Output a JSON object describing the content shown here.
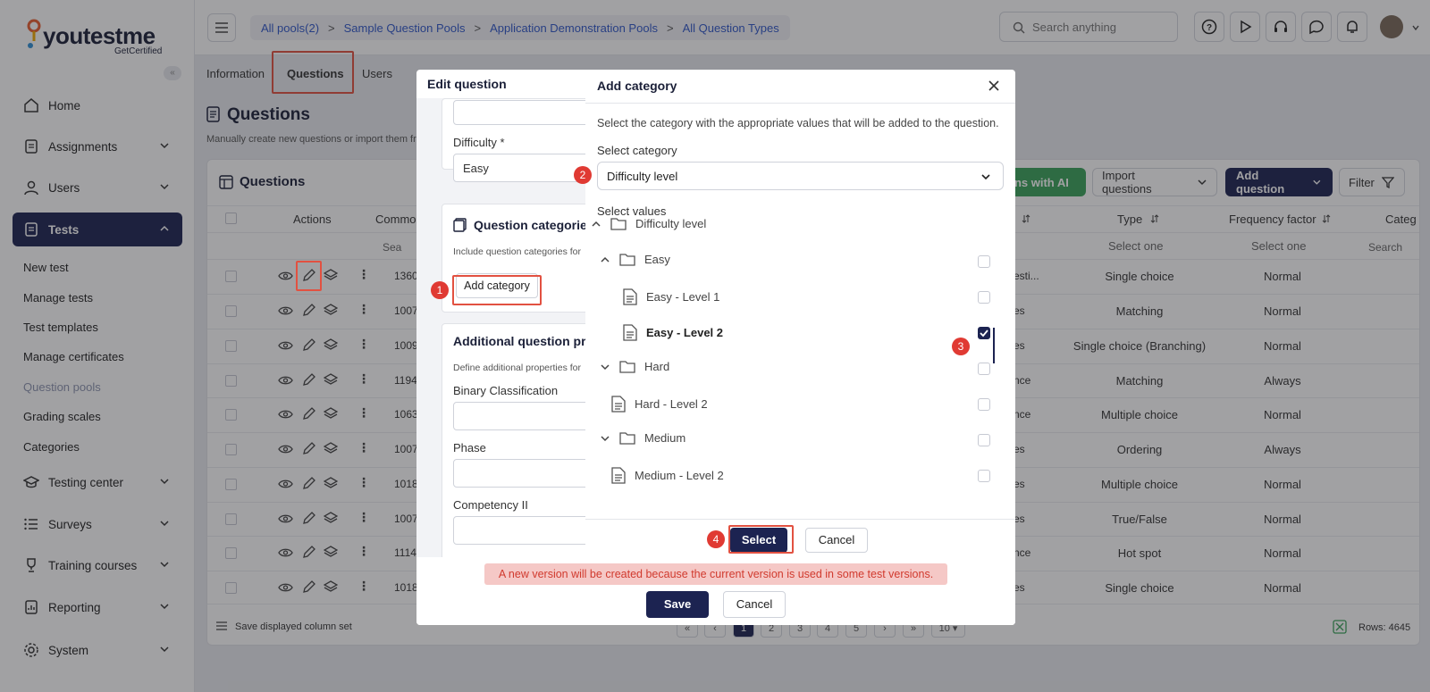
{
  "brand": {
    "logo_text": "youtestme",
    "logo_sub": "GetCertified",
    "accent": "#1c2351",
    "danger": "#e03a33"
  },
  "sidebar": {
    "collapse_glyph": "«",
    "items": [
      {
        "label": "Home",
        "icon": "home-icon"
      },
      {
        "label": "Assignments",
        "icon": "assignment-icon"
      },
      {
        "label": "Users",
        "icon": "user-icon"
      },
      {
        "label": "Tests",
        "icon": "test-icon"
      },
      {
        "label": "Testing center",
        "icon": "testing-center-icon"
      },
      {
        "label": "Surveys",
        "icon": "list-icon"
      },
      {
        "label": "Training courses",
        "icon": "trophy-icon"
      },
      {
        "label": "Reporting",
        "icon": "report-icon"
      },
      {
        "label": "System",
        "icon": "gear-icon"
      }
    ],
    "sub_items": [
      "New test",
      "Manage tests",
      "Test templates",
      "Manage certificates",
      "Question pools",
      "Grading scales",
      "Categories"
    ]
  },
  "header": {
    "breadcrumbs": [
      "All pools(2)",
      "Sample Question Pools",
      "Application Demonstration Pools",
      "All Question Types"
    ],
    "search_placeholder": "Search anything"
  },
  "tabs": [
    "Information",
    "Questions",
    "Users"
  ],
  "page": {
    "title": "Questions",
    "description": "Manually create new questions or import them fro",
    "card_title": "Questions",
    "buttons": {
      "ai": "tions with AI",
      "import": "Import questions",
      "add": "Add question",
      "filter": "Filter"
    },
    "columns": {
      "actions": "Actions",
      "common": "Commo",
      "type": "Type",
      "frequency": "Frequency factor",
      "category": "Categ"
    },
    "filters": {
      "common": "Sea",
      "type": "Select one",
      "frequency": "Select one",
      "category": "Search"
    },
    "rows": [
      {
        "id": "1360",
        "partial": "esti...",
        "type": "Single choice",
        "freq": "Normal"
      },
      {
        "id": "1007",
        "partial": "es",
        "type": "Matching",
        "freq": "Normal"
      },
      {
        "id": "1009",
        "partial": "es",
        "type": "Single choice (Branching)",
        "freq": "Normal"
      },
      {
        "id": "1194",
        "partial": "nce",
        "type": "Matching",
        "freq": "Always"
      },
      {
        "id": "1063",
        "partial": "nce",
        "type": "Multiple choice",
        "freq": "Normal"
      },
      {
        "id": "1007",
        "partial": "es",
        "type": "Ordering",
        "freq": "Always"
      },
      {
        "id": "1018",
        "partial": "es",
        "type": "Multiple choice",
        "freq": "Normal"
      },
      {
        "id": "1007",
        "partial": "es",
        "type": "True/False",
        "freq": "Normal"
      },
      {
        "id": "1114",
        "partial": "nce",
        "type": "Hot spot",
        "freq": "Normal"
      },
      {
        "id": "1018",
        "partial": "es",
        "type": "Single choice",
        "freq": "Normal"
      }
    ],
    "footer": {
      "save_columns": "Save displayed column set",
      "rows": "Rows: 4645",
      "page_size": "10",
      "pages": [
        "1",
        "2",
        "3",
        "4",
        "5"
      ]
    }
  },
  "edit_question": {
    "title": "Edit question",
    "difficulty_label": "Difficulty",
    "required_mark": "*",
    "difficulty_value": "Easy",
    "categories_title": "Question categories",
    "categories_desc": "Include question categories for",
    "add_category": "Add category",
    "additional_title": "Additional question pro",
    "additional_desc": "Define additional properties for",
    "fields": [
      "Binary Classification",
      "Phase",
      "Competency II"
    ],
    "warning": "A new version will be created because the current version is used in some test versions.",
    "save": "Save",
    "cancel": "Cancel"
  },
  "add_category": {
    "title": "Add category",
    "description": "Select the category with the appropriate values that will be added to the question.",
    "select_label": "Select category",
    "selected": "Difficulty level",
    "values_label": "Select values",
    "tree": [
      {
        "label": "Difficulty level",
        "kind": "folder",
        "checked": false
      },
      {
        "label": "Easy",
        "kind": "folder",
        "checked": false
      },
      {
        "label": "Easy - Level 1",
        "kind": "file",
        "checked": false
      },
      {
        "label": "Easy - Level 2",
        "kind": "file",
        "checked": true
      },
      {
        "label": "Hard",
        "kind": "folder",
        "checked": false
      },
      {
        "label": "Hard - Level 2",
        "kind": "file",
        "checked": false
      },
      {
        "label": "Medium",
        "kind": "folder",
        "checked": false
      },
      {
        "label": "Medium - Level 2",
        "kind": "file",
        "checked": false
      }
    ],
    "select_btn": "Select",
    "cancel_btn": "Cancel"
  },
  "steps": [
    "1",
    "2",
    "3",
    "4"
  ]
}
